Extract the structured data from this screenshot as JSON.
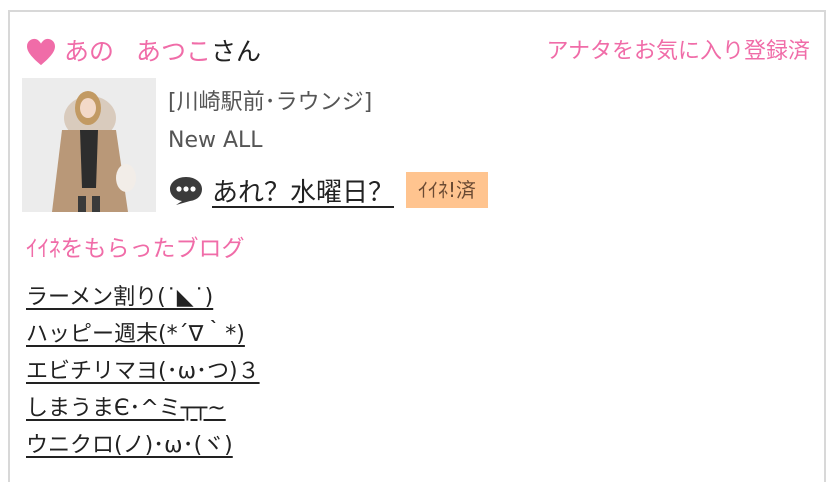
{
  "profile": {
    "name_part1": "あの",
    "name_part2": "あつこ",
    "honorific": "さん",
    "favorite_status": "アナタをお気に入り登録済"
  },
  "post": {
    "shop": "[川崎駅前･ラウンジ]",
    "category": "New ALL",
    "title": "あれ？水曜日？",
    "liked_badge": "ｲｲﾈ!済"
  },
  "liked_blogs": {
    "heading": "ｲｲﾈをもらったブログ",
    "items": [
      "ラーメン割り(˙◣˙)",
      "ハッピー週末(*´∇｀*)",
      "エビチリマヨ(･ω･つ)３",
      "しまうまЄ･^ミ┬┬~",
      "ウニクロ(ノ)･ω･(ヾ)"
    ]
  },
  "colors": {
    "accent": "#f06ca8",
    "badge": "#ffc48f",
    "border": "#d8d8d8"
  },
  "icons": [
    "heart-icon",
    "comment-bubble-icon"
  ]
}
